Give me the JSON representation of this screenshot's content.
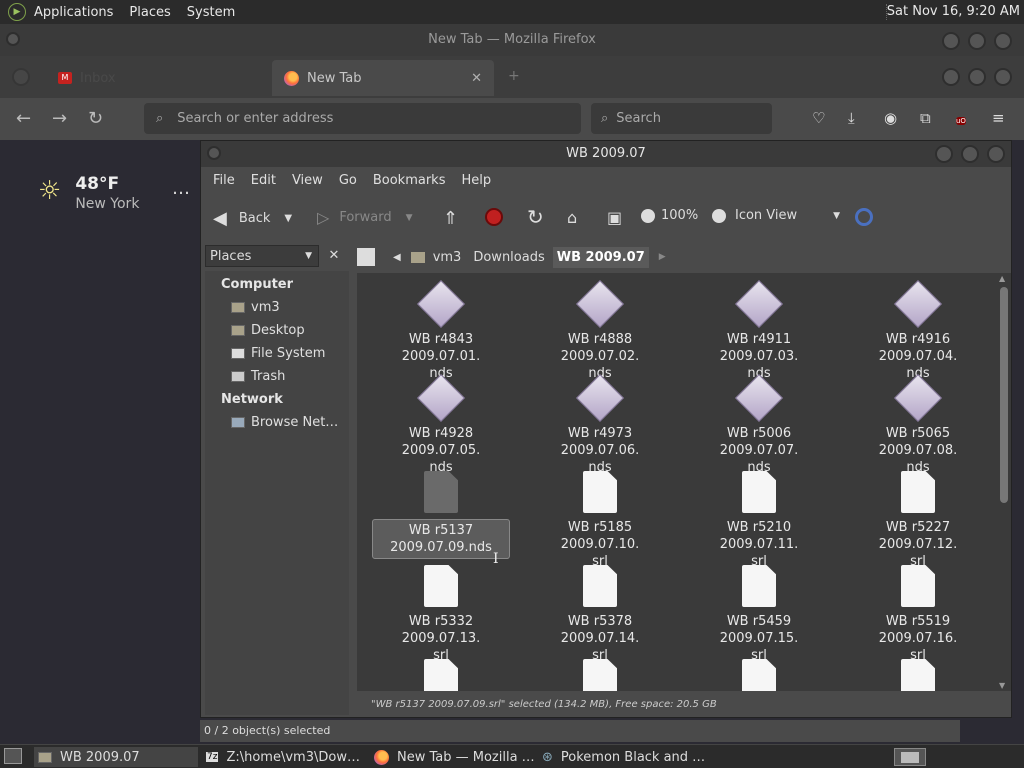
{
  "top_panel": {
    "menus": [
      "Applications",
      "Places",
      "System"
    ],
    "clock": "Sat Nov 16,  9:20 AM"
  },
  "firefox": {
    "window_title": "New Tab — Mozilla Firefox",
    "tabs": [
      {
        "label": "Inbox",
        "icon": "gmail-icon",
        "active": false
      },
      {
        "label": "New Tab",
        "icon": "firefox-icon",
        "active": true
      }
    ],
    "url_placeholder": "Search or enter address",
    "search_placeholder": "Search",
    "weather": {
      "temp": "48°F",
      "city": "New York",
      "more": "…"
    }
  },
  "file_manager": {
    "window_title": "WB 2009.07",
    "menu": [
      "File",
      "Edit",
      "View",
      "Go",
      "Bookmarks",
      "Help"
    ],
    "toolbar": {
      "back": "Back",
      "forward": "Forward",
      "zoom": "100%",
      "view_mode": "Icon View"
    },
    "places_label": "Places",
    "sidebar": {
      "computer_heading": "Computer",
      "computer_items": [
        "vm3",
        "Desktop",
        "File System",
        "Trash"
      ],
      "network_heading": "Network",
      "network_items": [
        "Browse Net…"
      ]
    },
    "path": [
      "vm3",
      "Downloads",
      "WB 2009.07"
    ],
    "files": [
      {
        "line1": "WB r4843 2009.07.01.",
        "line2": "nds",
        "type": "nds"
      },
      {
        "line1": "WB r4888 2009.07.02.",
        "line2": "nds",
        "type": "nds"
      },
      {
        "line1": "WB r4911 2009.07.03.",
        "line2": "nds",
        "type": "nds"
      },
      {
        "line1": "WB r4916 2009.07.04.",
        "line2": "nds",
        "type": "nds"
      },
      {
        "line1": "WB r4928 2009.07.05.",
        "line2": "nds",
        "type": "nds"
      },
      {
        "line1": "WB r4973 2009.07.06.",
        "line2": "nds",
        "type": "nds"
      },
      {
        "line1": "WB r5006 2009.07.07.",
        "line2": "nds",
        "type": "nds"
      },
      {
        "line1": "WB r5065 2009.07.08.",
        "line2": "nds",
        "type": "nds"
      },
      {
        "line1": "WB r5137",
        "line2": "2009.07.09.nds",
        "type": "srl-selected"
      },
      {
        "line1": "WB r5185 2009.07.10.",
        "line2": "srl",
        "type": "srl"
      },
      {
        "line1": "WB r5210 2009.07.11.",
        "line2": "srl",
        "type": "srl"
      },
      {
        "line1": "WB r5227 2009.07.12.",
        "line2": "srl",
        "type": "srl"
      },
      {
        "line1": "WB r5332 2009.07.13.",
        "line2": "srl",
        "type": "srl"
      },
      {
        "line1": "WB r5378 2009.07.14.",
        "line2": "srl",
        "type": "srl"
      },
      {
        "line1": "WB r5459 2009.07.15.",
        "line2": "srl",
        "type": "srl"
      },
      {
        "line1": "WB r5519 2009.07.16.",
        "line2": "srl",
        "type": "srl"
      }
    ],
    "status": "\"WB r5137 2009.07.09.srl\" selected (134.2 MB), Free space: 20.5 GB",
    "status_left": "0 / 2 object(s) selected"
  },
  "taskbar": {
    "items": [
      {
        "label": "WB 2009.07",
        "icon": "folder-icon",
        "active": true
      },
      {
        "label": "Z:\\home\\vm3\\Dow…",
        "icon": "7zip-icon",
        "active": false
      },
      {
        "label": "New Tab — Mozilla …",
        "icon": "firefox-icon",
        "active": false
      },
      {
        "label": "Pokemon Black and …",
        "icon": "emulator-icon",
        "active": false
      }
    ]
  }
}
